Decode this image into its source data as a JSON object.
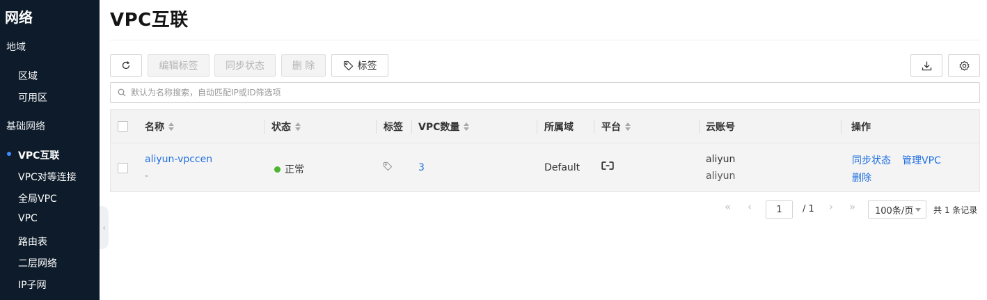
{
  "sidebar": {
    "title": "网络",
    "groups": [
      "地域",
      "基础网络"
    ],
    "region_items": [
      "区域",
      "可用区"
    ],
    "network_items": [
      "VPC互联",
      "VPC对等连接",
      "全局VPC",
      "VPC",
      "路由表",
      "二层网络",
      "IP子网"
    ],
    "active_item": "VPC互联",
    "collapse_icon": "chevron-left-icon"
  },
  "page": {
    "title": "VPC互联"
  },
  "toolbar": {
    "refresh_icon": "refresh-icon",
    "edit_tags_label": "编辑标签",
    "sync_status_label": "同步状态",
    "delete_label": "删 除",
    "tags_label": "标签",
    "download_icon": "download-icon",
    "settings_icon": "gear-icon"
  },
  "search": {
    "placeholder": "默认为名称搜索，自动匹配IP或ID筛选项"
  },
  "table": {
    "columns": [
      "名称",
      "状态",
      "标签",
      "VPC数量",
      "所属域",
      "平台",
      "云账号",
      "操作"
    ],
    "rows": [
      {
        "name": "aliyun-vpccen",
        "name_sub": "-",
        "status": "正常",
        "status_color": "#4cb62d",
        "vpc_count": "3",
        "domain": "Default",
        "platform_icon": "aliyun-logo-icon",
        "account": "aliyun",
        "account_sub": "aliyun",
        "actions": [
          "同步状态",
          "管理VPC",
          "删除"
        ]
      }
    ]
  },
  "pagination": {
    "current_page": "1",
    "total_pages": "/ 1",
    "page_size": "100条/页",
    "total_text": "共 1 条记录"
  },
  "colors": {
    "sidebar_bg": "#0d1b2a",
    "link": "#1f6fe0",
    "active_dot": "#3f8cff"
  }
}
